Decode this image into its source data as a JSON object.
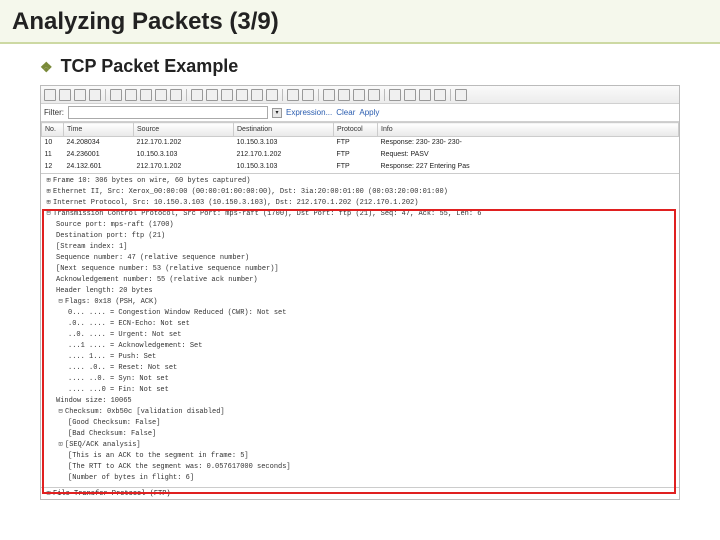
{
  "slide": {
    "title": "Analyzing Packets (3/9)",
    "subtitle": "TCP Packet Example"
  },
  "filter": {
    "label": "Filter:",
    "value": "",
    "btn_expression": "Expression...",
    "btn_clear": "Clear",
    "btn_apply": "Apply"
  },
  "columns": {
    "no": "No.",
    "time": "Time",
    "source": "Source",
    "destination": "Destination",
    "protocol": "Protocol",
    "info": "Info"
  },
  "rows": [
    {
      "no": "10",
      "time": "24.208034",
      "source": "212.170.1.202",
      "destination": "10.150.3.103",
      "protocol": "FTP",
      "info": "Response: 230-  230-   230-"
    },
    {
      "no": "11",
      "time": "24.236001",
      "source": "10.150.3.103",
      "destination": "212.170.1.202",
      "protocol": "FTP",
      "info": "Request: PASV"
    },
    {
      "no": "12",
      "time": "24.132.601",
      "source": "212.170.1.202",
      "destination": "10.150.3.103",
      "protocol": "FTP",
      "info": "Response: 227 Entering Pas"
    }
  ],
  "details": {
    "frame": "Frame 10: 306 bytes on wire, 60 bytes captured)",
    "eth": "Ethernet II, Src: Xerox_00:00:00 (00:00:01:00:00:00), Dst: 3ia:20:00:01:00 (00:03:20:00:01:00)",
    "ip": "Internet Protocol, Src: 10.150.3.103 (10.150.3.103), Dst: 212.170.1.202 (212.170.1.202)",
    "tcp_summary": "Transmission Control Protocol, Src Port: mps-raft (1700), Dst Port: ftp (21), Seq: 47, Ack: 55, Len: 6",
    "tcp": {
      "src_port": "Source port: mps-raft (1700)",
      "dst_port": "Destination port: ftp (21)",
      "stream": "[Stream index: 1]",
      "seq": "Sequence number: 47    (relative sequence number)",
      "next_seq": "[Next sequence number: 53    (relative sequence number)]",
      "ack": "Acknowledgement number: 55    (relative ack number)",
      "hdr_len": "Header length: 20 bytes",
      "flags_summary": "Flags: 0x18 (PSH, ACK)",
      "flags": {
        "cwr": "0... .... = Congestion Window Reduced (CWR): Not set",
        "ecn": ".0.. .... = ECN-Echo: Not set",
        "urg": "..0. .... = Urgent: Not set",
        "ack": "...1 .... = Acknowledgement: Set",
        "psh": ".... 1... = Push: Set",
        "rst": ".... .0.. = Reset: Not set",
        "syn": ".... ..0. = Syn: Not set",
        "fin": ".... ...0 = Fin: Not set"
      },
      "win": "Window size: 10065",
      "cksum_summary": "Checksum: 0xb50c [validation disabled]",
      "cksum": {
        "good": "[Good Checksum: False]",
        "bad": "[Bad Checksum: False]"
      },
      "seq_ack_summary": "[SEQ/ACK analysis]",
      "seq_ack": {
        "ack_to": "[This is an ACK to the segment in frame: 5]",
        "rtt": "[The RTT to ACK the segment was: 0.057617000 seconds]",
        "bytes": "[Number of bytes in flight: 6]"
      }
    },
    "ftp": "File Transfer Protocol (FTP)"
  }
}
